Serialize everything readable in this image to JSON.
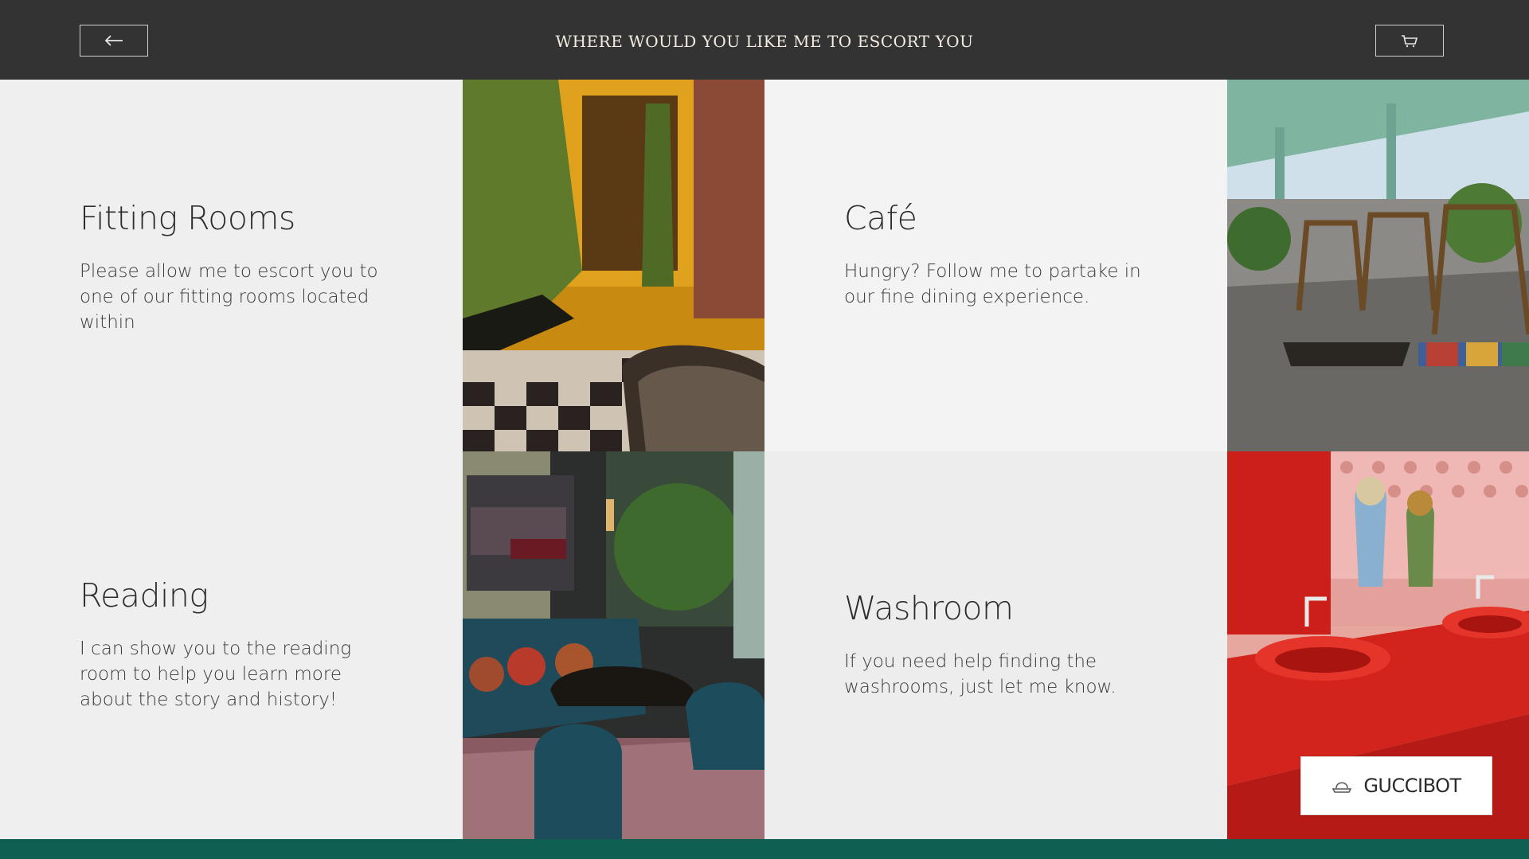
{
  "header": {
    "title": "WHERE WOULD YOU LIKE ME TO ESCORT YOU",
    "back_icon": "arrow-left-icon",
    "cart_icon": "shopping-cart-icon"
  },
  "tiles": [
    {
      "title": "Fitting Rooms",
      "description": "Please allow me to escort you to one of our fitting rooms located within"
    },
    {
      "title": "Café",
      "description": "Hungry? Follow me to partake in our fine dining experience."
    },
    {
      "title": "Reading",
      "description": "I can show you to the reading room to help you learn more about the story and history!"
    },
    {
      "title": "Washroom",
      "description": "If you need help finding the washrooms, just let me know."
    }
  ],
  "assistant": {
    "label": "GUCCIBOT",
    "icon": "bot-hat-icon"
  },
  "colors": {
    "header_bg": "#333333",
    "accent_green": "#0f5f52",
    "panel_light": "#efefef",
    "panel_lighter": "#f3f3f3"
  }
}
